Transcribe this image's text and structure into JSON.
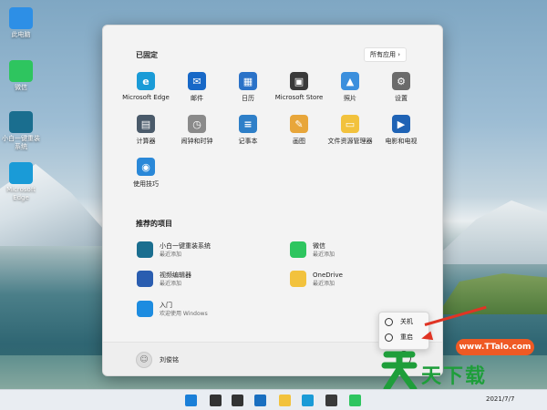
{
  "desktop": {
    "icons": [
      {
        "label": "此电脑",
        "name": "this-pc-icon",
        "color": "#2d8fe6"
      },
      {
        "label": "微信",
        "name": "wechat-icon",
        "color": "#2ec55f"
      },
      {
        "label": "小白一键重装系统",
        "name": "xiaobai-icon",
        "color": "#1a6e8f"
      },
      {
        "label": "Microsoft Edge",
        "name": "edge-icon",
        "color": "#1a9bd7"
      }
    ]
  },
  "start": {
    "pinned_title": "已固定",
    "all_apps": "所有应用 ›",
    "pinned": [
      {
        "label": "Microsoft Edge",
        "icon": "edge-icon",
        "color": "#1a9bd7",
        "glyph": "e"
      },
      {
        "label": "邮件",
        "icon": "mail-icon",
        "color": "#1768c7",
        "glyph": "✉"
      },
      {
        "label": "日历",
        "icon": "calendar-icon",
        "color": "#2a72c8",
        "glyph": "▦"
      },
      {
        "label": "Microsoft Store",
        "icon": "store-icon",
        "color": "#3a3a3a",
        "glyph": "▣"
      },
      {
        "label": "照片",
        "icon": "photos-icon",
        "color": "#3b8fdd",
        "glyph": "▲"
      },
      {
        "label": "设置",
        "icon": "settings-icon",
        "color": "#6b6b6b",
        "glyph": "⚙"
      },
      {
        "label": "计算器",
        "icon": "calculator-icon",
        "color": "#4a5a6a",
        "glyph": "▤"
      },
      {
        "label": "闹钟和时钟",
        "icon": "clock-icon",
        "color": "#8a8a8a",
        "glyph": "◷"
      },
      {
        "label": "记事本",
        "icon": "notepad-icon",
        "color": "#2e7fc8",
        "glyph": "≡"
      },
      {
        "label": "画图",
        "icon": "paint-icon",
        "color": "#e8a63a",
        "glyph": "✎"
      },
      {
        "label": "文件资源管理器",
        "icon": "folder-icon",
        "color": "#f2c23d",
        "glyph": "▭"
      },
      {
        "label": "电影和电视",
        "icon": "movies-icon",
        "color": "#1f63b5",
        "glyph": "▶"
      },
      {
        "label": "使用技巧",
        "icon": "tips-icon",
        "color": "#2a88d8",
        "glyph": "◉"
      }
    ],
    "recommended_title": "推荐的项目",
    "recommended": [
      {
        "title": "小白一键重装系统",
        "sub": "最近添加",
        "icon": "xiaobai-icon",
        "color": "#1a6e8f"
      },
      {
        "title": "微信",
        "sub": "最近添加",
        "icon": "wechat-icon",
        "color": "#2ec55f"
      },
      {
        "title": "视频编辑器",
        "sub": "最近添加",
        "icon": "video-editor-icon",
        "color": "#2a5db0"
      },
      {
        "title": "OneDrive",
        "sub": "最近添加",
        "icon": "onedrive-icon",
        "color": "#f2c23d"
      },
      {
        "title": "入门",
        "sub": "欢迎使用 Windows",
        "icon": "get-started-icon",
        "color": "#1d8ce0"
      }
    ],
    "user": "刘俊铭",
    "power_menu": {
      "shutdown": "关机",
      "restart": "重启"
    }
  },
  "taskbar": {
    "date": "2021/7/7",
    "icons": [
      {
        "name": "windows-start-icon",
        "color": "#1a7fd8"
      },
      {
        "name": "search-icon",
        "color": "#333333"
      },
      {
        "name": "task-view-icon",
        "color": "#333333"
      },
      {
        "name": "widgets-icon",
        "color": "#1a6fc0"
      },
      {
        "name": "file-explorer-icon",
        "color": "#f2c23d"
      },
      {
        "name": "edge-icon",
        "color": "#1a9bd7"
      },
      {
        "name": "store-icon",
        "color": "#3a3a3a"
      },
      {
        "name": "wechat-icon",
        "color": "#2ec55f"
      }
    ]
  },
  "watermark": {
    "url": "www.TTalo.com",
    "brand": "天下载"
  }
}
